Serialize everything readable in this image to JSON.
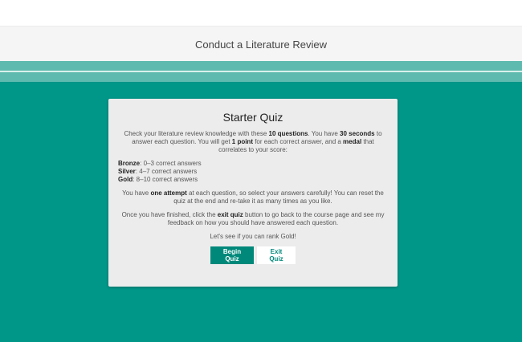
{
  "page": {
    "title": "Conduct a Literature Review"
  },
  "quiz": {
    "heading": "Starter Quiz",
    "intro": {
      "p1_a": "Check your literature review knowledge with these ",
      "p1_b": "10 questions",
      "p1_c": ". You have ",
      "p1_d": "30 seconds",
      "p1_e": " to answer each question. You will get ",
      "p1_f": "1 point",
      "p1_g": " for each correct answer, and a ",
      "p1_h": "medal",
      "p1_i": " that correlates to your score:"
    },
    "medals": [
      {
        "name": "Bronze",
        "range": ": 0–3 correct answers"
      },
      {
        "name": "Silver",
        "range": ": 4–7 correct answers"
      },
      {
        "name": "Gold",
        "range": ": 8–10 correct answers"
      }
    ],
    "attempt": {
      "a": "You have ",
      "b": "one attempt",
      "c": " at each question, so select your answers carefully! You can reset the quiz at the end and re-take it as many times as you like."
    },
    "finish": {
      "a": "Once you have finished, click the ",
      "b": "exit quiz",
      "c": " button to go back to the course page and see my feedback on how you should have answered each question."
    },
    "closing": "Let's see if you can rank Gold!",
    "begin_label": "Begin Quiz",
    "exit_label": "Exit Quiz"
  },
  "colors": {
    "background": "#009688",
    "band": "#5ebaae",
    "button": "#00897b",
    "card": "#ececec"
  }
}
